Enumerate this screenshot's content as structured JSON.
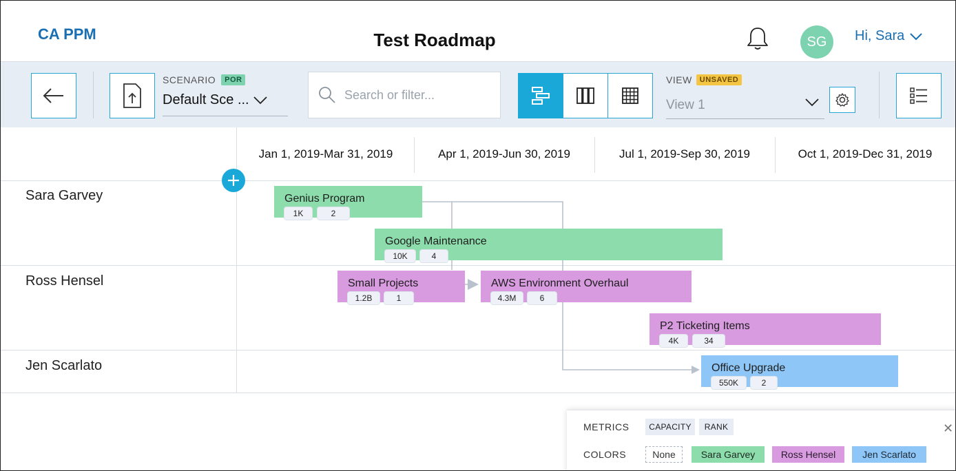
{
  "header": {
    "brand": "CA PPM",
    "title": "Test Roadmap",
    "avatar_initials": "SG",
    "greeting": "Hi, Sara"
  },
  "toolbar": {
    "scenario_label": "SCENARIO",
    "scenario_badge": "POR",
    "scenario_value": "Default Sce ...",
    "search_placeholder": "Search or filter...",
    "view_label": "VIEW",
    "view_badge": "UNSAVED",
    "view_value": "View 1"
  },
  "timeline": {
    "quarters": [
      "Jan 1, 2019-Mar 31, 2019",
      "Apr 1, 2019-Jun 30, 2019",
      "Jul 1, 2019-Sep 30, 2019",
      "Oct 1, 2019-Dec 31, 2019"
    ]
  },
  "rows": [
    "Sara Garvey",
    "Ross Hensel",
    "Jen Scarlato"
  ],
  "items": [
    {
      "name": "Genius Program",
      "capacity": "1K",
      "rank": "2",
      "owner": "Sara Garvey"
    },
    {
      "name": "Google Maintenance",
      "capacity": "10K",
      "rank": "4",
      "owner": "Sara Garvey"
    },
    {
      "name": "Small Projects",
      "capacity": "1.2B",
      "rank": "1",
      "owner": "Ross Hensel"
    },
    {
      "name": "AWS Environment Overhaul",
      "capacity": "4.3M",
      "rank": "6",
      "owner": "Ross Hensel"
    },
    {
      "name": "P2 Ticketing Items",
      "capacity": "4K",
      "rank": "34",
      "owner": "Ross Hensel"
    },
    {
      "name": "Office Upgrade",
      "capacity": "550K",
      "rank": "2",
      "owner": "Jen Scarlato"
    }
  ],
  "panel": {
    "metrics_label": "METRICS",
    "metrics": [
      "CAPACITY",
      "RANK"
    ],
    "colors_label": "COLORS",
    "colors": [
      "None",
      "Sara Garvey",
      "Ross Hensel",
      "Jen Scarlato"
    ]
  },
  "colors": {
    "sara": "#8ddcac",
    "ross": "#d89be0",
    "jen": "#8ec7f7",
    "accent": "#1aa8d9"
  },
  "icons": [
    "back-arrow-icon",
    "export-icon",
    "search-icon",
    "chevron-down-icon",
    "bell-icon",
    "timeline-view-icon",
    "board-view-icon",
    "grid-view-icon",
    "gear-icon",
    "list-icon",
    "add-icon",
    "close-icon"
  ]
}
